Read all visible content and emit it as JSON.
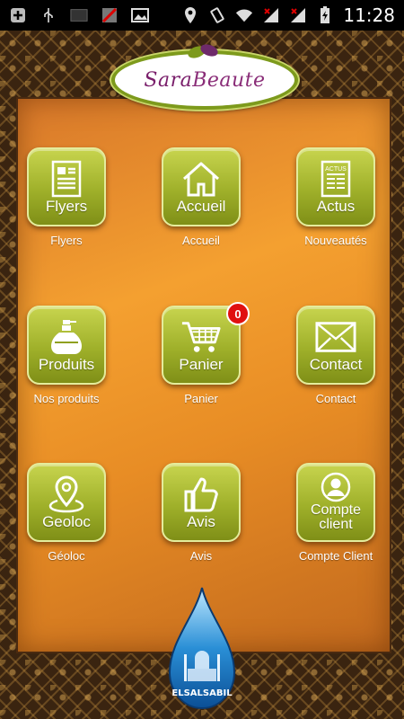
{
  "status_bar": {
    "time": "11:28",
    "left_icons": [
      "plus-icon",
      "usb-icon",
      "screen-icon",
      "no-signal-icon",
      "photo-icon"
    ],
    "right_icons": [
      "location-icon",
      "vibrate-icon",
      "wifi-icon",
      "signal-x-icon",
      "signal-x-icon",
      "battery-charging-icon"
    ]
  },
  "logo": {
    "text_a": "Sara",
    "text_b": "Beaute"
  },
  "tiles": [
    {
      "label": "Flyers",
      "caption": "Flyers",
      "icon": "document-icon"
    },
    {
      "label": "Accueil",
      "caption": "Accueil",
      "icon": "home-icon"
    },
    {
      "label": "Actus",
      "caption": "Nouveautés",
      "icon": "news-icon",
      "icon_text": "ACTUS"
    },
    {
      "label": "Produits",
      "caption": "Nos produits",
      "icon": "bottle-icon"
    },
    {
      "label": "Panier",
      "caption": "Panier",
      "icon": "cart-icon",
      "badge": "0"
    },
    {
      "label": "Contact",
      "caption": "Contact",
      "icon": "envelope-icon"
    },
    {
      "label": "Geoloc",
      "caption": "Géoloc",
      "icon": "map-pin-icon"
    },
    {
      "label": "Avis",
      "caption": "Avis",
      "icon": "thumbs-up-icon"
    },
    {
      "label": "Compte client",
      "caption": "Compte Client",
      "icon": "user-icon"
    }
  ],
  "footer_logo": {
    "text": "ELSALSABIL"
  },
  "colors": {
    "button": "#9fb02a",
    "panel": "#f4a030",
    "badge": "#e01010",
    "logo_text": "#7a1f6b"
  }
}
